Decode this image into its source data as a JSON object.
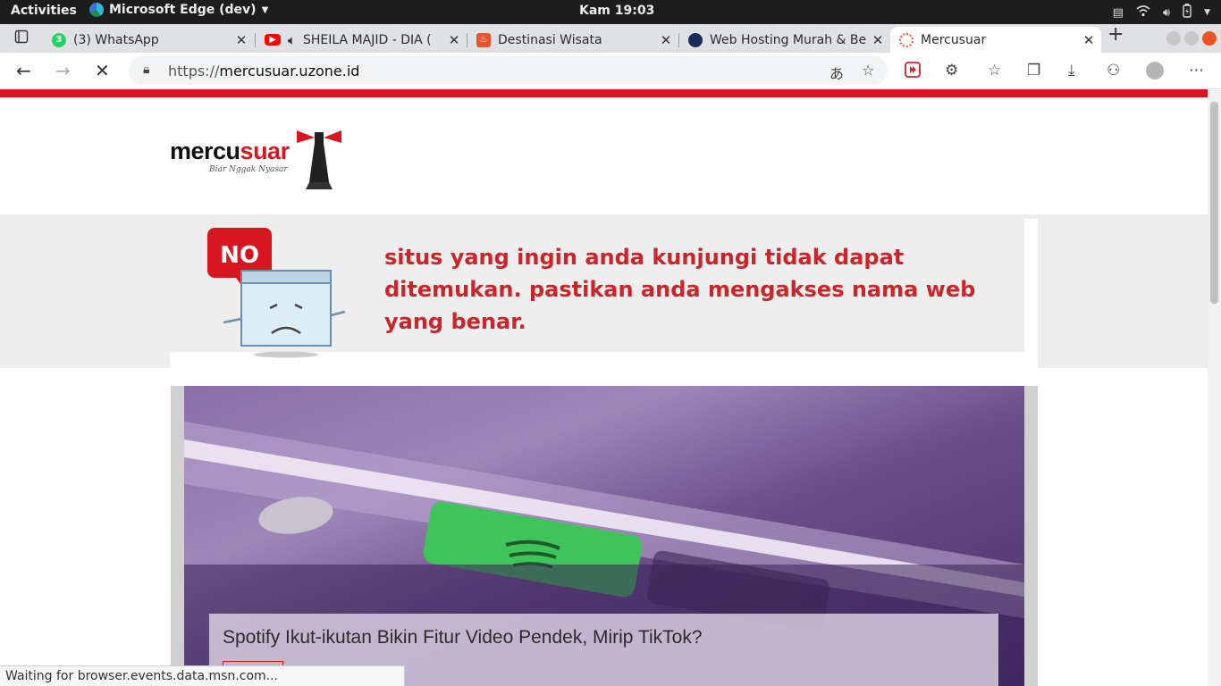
{
  "system": {
    "activities": "Activities",
    "app_name": "Microsoft Edge (dev)",
    "clock": "Kam 19:03"
  },
  "tabs": [
    {
      "title": "(3) WhatsApp",
      "favicon": "whatsapp-icon",
      "badge": "3"
    },
    {
      "title": "SHEILA MAJID - DIA (",
      "favicon": "youtube-icon"
    },
    {
      "title": "Destinasi Wisata",
      "favicon": "flame-icon"
    },
    {
      "title": "Web Hosting Murah & Be",
      "favicon": "globe-icon"
    },
    {
      "title": "Mercusuar",
      "favicon": "mercusuar-icon",
      "active": true
    }
  ],
  "omnibox": {
    "scheme": "https://",
    "host": "mercusuar.uzone.id"
  },
  "page": {
    "logo_word_a": "mercu",
    "logo_word_b": "suar",
    "logo_tagline": "Biar Nggak Nyasar",
    "notfound_badge": "NO",
    "notfound_message": "situs yang ingin anda kunjungi tidak dapat ditemukan. pastikan anda mengakses nama web yang benar.",
    "headline": "Spotify Ikut-ikutan Bikin Fitur Video Pendek, Mirip TikTok?"
  },
  "status": "Waiting for browser.events.data.msn.com...",
  "colors": {
    "brand_red": "#d7161f",
    "message_red": "#c9252b",
    "hero_purple": "#6b4e8a",
    "spotify_green": "#3ec45a"
  }
}
